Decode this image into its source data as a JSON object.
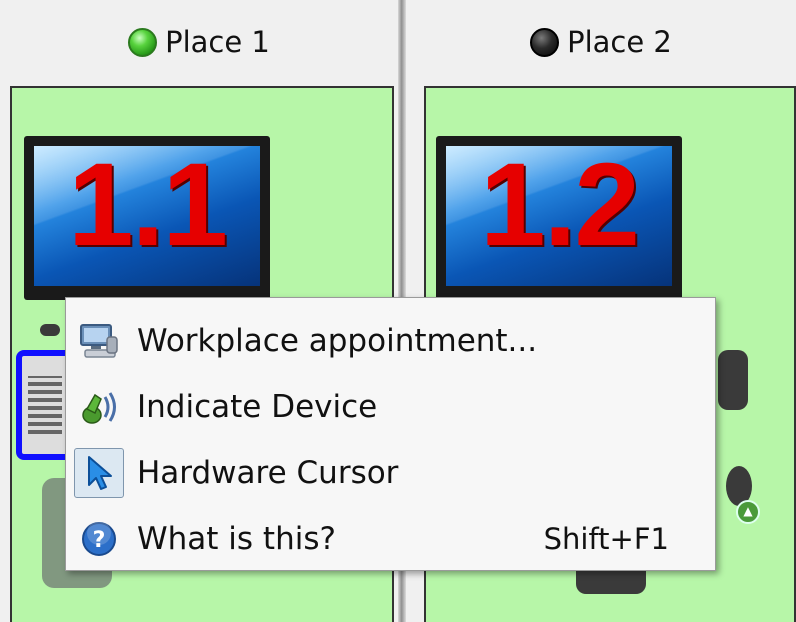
{
  "places": [
    {
      "title": "Place 1",
      "status": "green",
      "monitor_label": "1.1"
    },
    {
      "title": "Place 2",
      "status": "black",
      "monitor_label": "1.2"
    }
  ],
  "context_menu": {
    "items": [
      {
        "label": "Workplace appointment...",
        "icon": "workplace-icon",
        "shortcut": ""
      },
      {
        "label": "Indicate Device",
        "icon": "indicate-device-icon",
        "shortcut": ""
      },
      {
        "label": "Hardware Cursor",
        "icon": "cursor-icon",
        "shortcut": "",
        "checked": true
      },
      {
        "label": "What is this?",
        "icon": "help-icon",
        "shortcut": "Shift+F1"
      }
    ]
  },
  "colors": {
    "panel_bg": "#b7f6a8",
    "monitor_label": "#e60000",
    "selected_border": "#1010ff"
  }
}
